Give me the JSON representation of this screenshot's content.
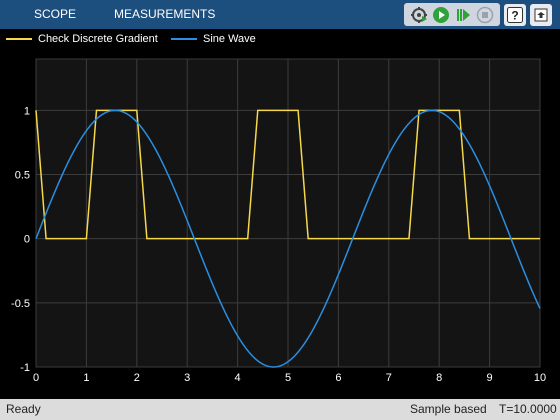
{
  "toolstrip": {
    "tabs": [
      {
        "label": "SCOPE"
      },
      {
        "label": "MEASUREMENTS"
      }
    ],
    "buttons": [
      {
        "icon": "step-settings-icon"
      },
      {
        "icon": "run-icon"
      },
      {
        "icon": "step-forward-icon"
      },
      {
        "icon": "stop-icon"
      },
      {
        "icon": "help-icon"
      },
      {
        "icon": "undock-icon"
      }
    ]
  },
  "legend": {
    "items": [
      {
        "label": "Check Discrete Gradient",
        "color": "#f5d94a"
      },
      {
        "label": "Sine Wave",
        "color": "#2b8ee0"
      }
    ]
  },
  "chart_data": {
    "type": "line",
    "xlim": [
      0,
      10
    ],
    "ylim": [
      -1,
      1.4
    ],
    "xticks": [
      0,
      1,
      2,
      3,
      4,
      5,
      6,
      7,
      8,
      9,
      10
    ],
    "yticks": [
      -1,
      -0.5,
      0,
      0.5,
      1
    ],
    "ytick_labels": [
      "-1",
      "-0.5",
      "0",
      "0.5",
      "1"
    ],
    "grid": true,
    "legend_position": "top",
    "series": [
      {
        "name": "Check Discrete Gradient",
        "color": "#f5d94a",
        "x": [
          0,
          0.2,
          1.0,
          1.2,
          2.0,
          2.2,
          4.2,
          4.4,
          5.2,
          5.4,
          7.4,
          7.6,
          8.4,
          8.6,
          10
        ],
        "y": [
          1,
          0,
          0,
          1,
          1,
          0,
          0,
          1,
          1,
          0,
          0,
          1,
          1,
          0,
          0
        ]
      },
      {
        "name": "Sine Wave",
        "color": "#2b8ee0",
        "function": "sin",
        "x_range": [
          0,
          10
        ]
      }
    ]
  },
  "status": {
    "left": "Ready",
    "mode": "Sample based",
    "time": "T=10.0000"
  }
}
